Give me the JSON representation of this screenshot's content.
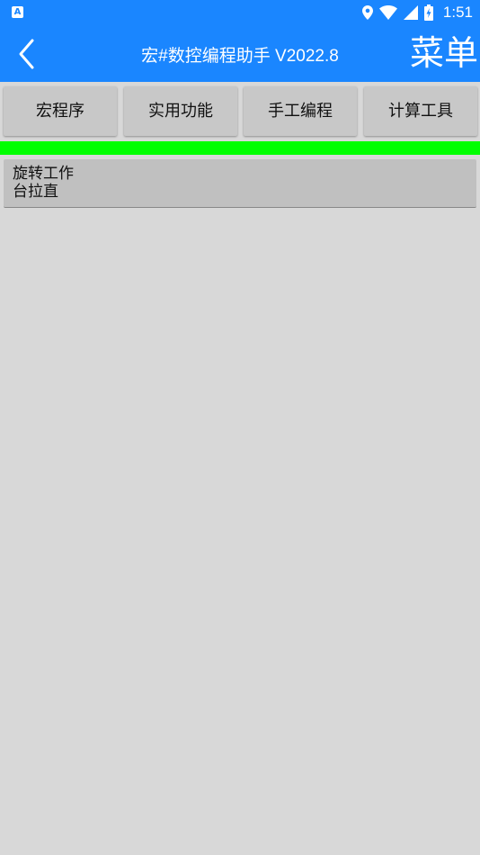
{
  "status_bar": {
    "time": "1:51",
    "icons": [
      "notification-a-icon",
      "location-icon",
      "wifi-icon",
      "signal-icon",
      "battery-charging-icon"
    ],
    "color": "#1a86ff"
  },
  "app_bar": {
    "title": "宏#数控编程助手 V2022.8",
    "menu_label": "菜单",
    "back_icon": "chevron-left-icon",
    "color": "#1a86ff"
  },
  "tabs": [
    {
      "label": "宏程序"
    },
    {
      "label": "实用功能"
    },
    {
      "label": "手工编程"
    },
    {
      "label": "计算工具"
    }
  ],
  "indicator_color": "#00ff00",
  "list": {
    "items": [
      {
        "label": "旋转工作台拉直"
      }
    ]
  }
}
